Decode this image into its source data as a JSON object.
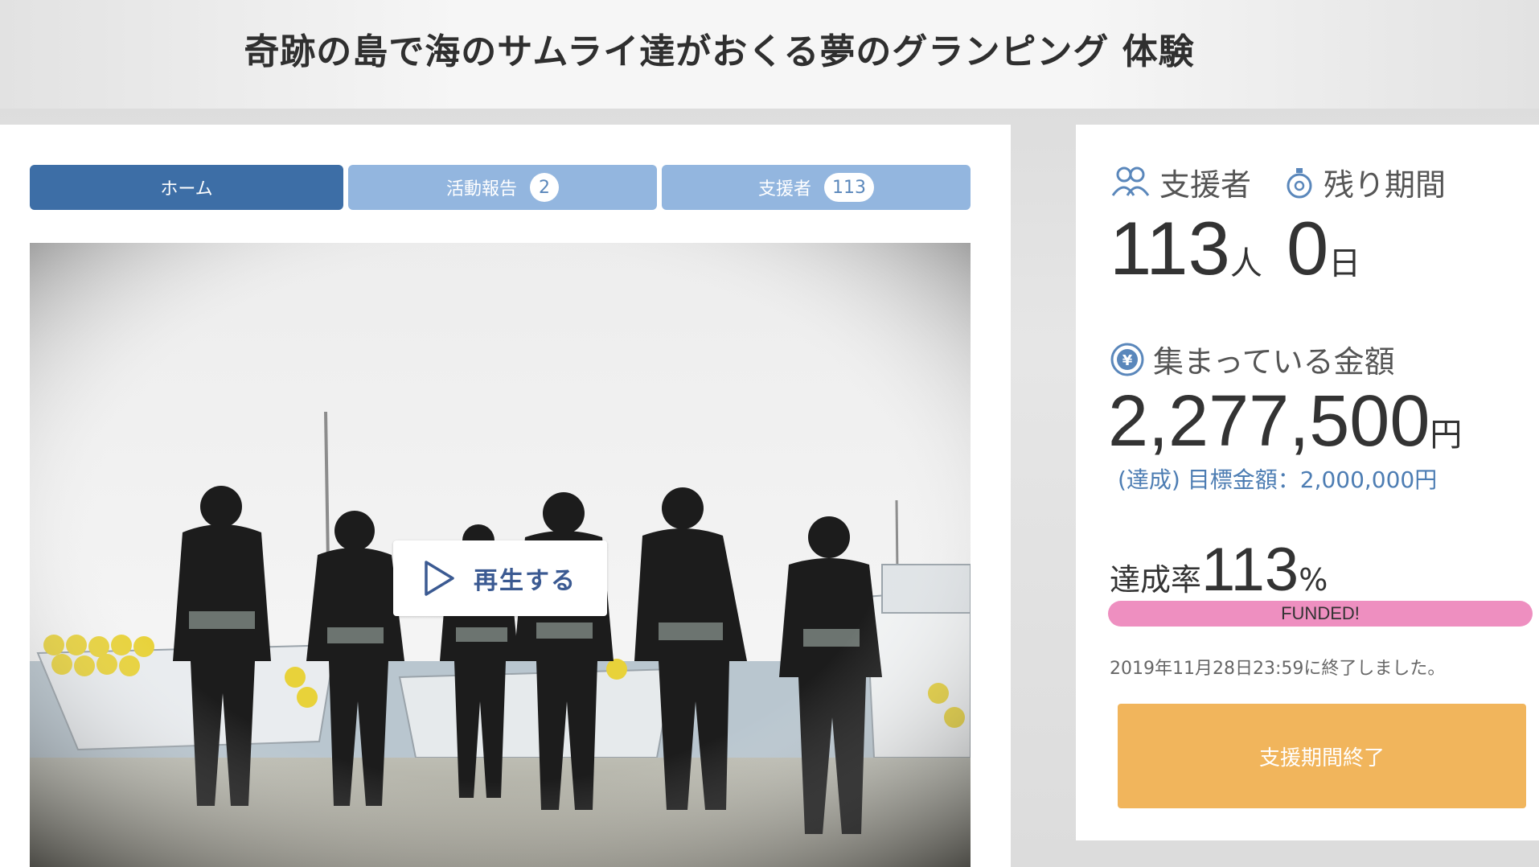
{
  "header": {
    "title": "奇跡の島で海のサムライ達がおくる夢のグランピング 体験"
  },
  "tabs": [
    {
      "label": "ホーム"
    },
    {
      "label": "活動報告",
      "count": "2"
    },
    {
      "label": "支援者",
      "count": "113"
    }
  ],
  "video": {
    "play_label": "再生する"
  },
  "stats": {
    "supporters_label": "支援者",
    "supporters_value": "113",
    "supporters_unit": "人",
    "remaining_label": "残り期間",
    "remaining_value": "0",
    "remaining_unit": "日",
    "amount_label": "集まっている金額",
    "amount_value": "2,277,500",
    "amount_unit": "円",
    "goal_text": "(達成) 目標金額：2,000,000円",
    "rate_label": "達成率",
    "rate_value": "113",
    "rate_unit": "%",
    "progress_percent": 113,
    "progress_label": "FUNDED!",
    "end_text": "2019年11月28日23:59に終了しました。",
    "end_button": "支援期間終了"
  },
  "colors": {
    "tab_active": "#3d6ea6",
    "tab_inactive": "#93b6df",
    "progress": "#ee8fc0",
    "end_button": "#f1b55c",
    "icon_blue": "#5a87bb"
  }
}
